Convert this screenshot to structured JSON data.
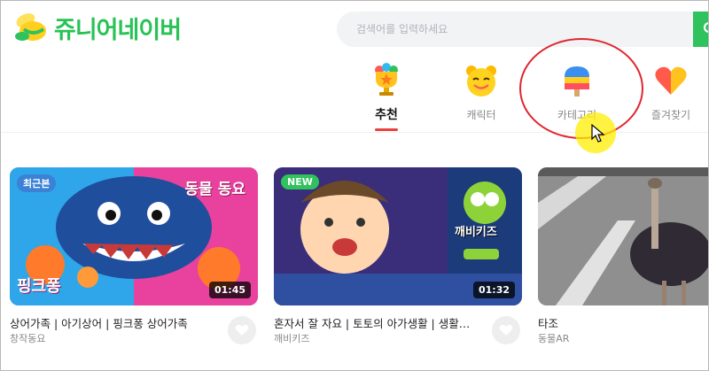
{
  "header": {
    "logo_text": "쥬니어네이버",
    "search": {
      "placeholder": "검색어를 입력하세요"
    }
  },
  "nav": {
    "items": [
      {
        "label": "추천",
        "icon": "trophy-icon",
        "active": true
      },
      {
        "label": "캐릭터",
        "icon": "character-face-icon",
        "active": false
      },
      {
        "label": "카테고리",
        "icon": "popsicle-icon",
        "active": false
      },
      {
        "label": "즐겨찾기",
        "icon": "heart-icon",
        "active": false
      }
    ]
  },
  "annotation": {
    "color": "#e0262f"
  },
  "videos": [
    {
      "title": "상어가족 | 아기상어 | 핑크퐁 상어가족",
      "channel": "창작동요",
      "badge": "최근본",
      "duration": "01:45",
      "thumb_text_top": "동물 동요",
      "thumb_text_bottom": "핑크퐁"
    },
    {
      "title": "혼자서 잘 자요 | 토토의 아가생활 | 생활습…",
      "channel": "깨비키즈",
      "badge": "NEW",
      "duration": "01:32",
      "thumb_text_top": "깨비키즈"
    },
    {
      "title": "타조",
      "channel": "동물AR"
    }
  ],
  "colors": {
    "accent_green": "#2fc25d",
    "active_underline": "#e8433e",
    "badge_recent": "#3b82d6",
    "badge_new": "#2fc25d"
  }
}
